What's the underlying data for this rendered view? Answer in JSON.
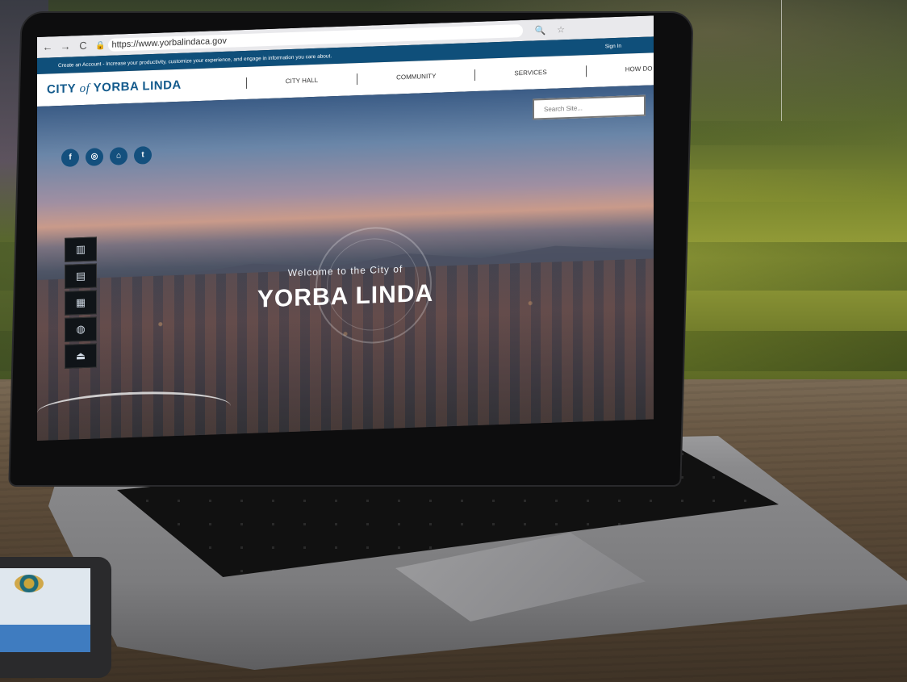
{
  "browser": {
    "url": "https://www.yorbalindaca.gov",
    "back_glyph": "←",
    "forward_glyph": "→",
    "reload_glyph": "C",
    "lock_glyph": "🔒",
    "search_glyph": "🔍",
    "star_glyph": "☆"
  },
  "promo": {
    "text": "Create an Account - Increase your productivity, customize your experience, and engage in information you care about.",
    "sign_in": "Sign In"
  },
  "header": {
    "logo_prefix": "CITY",
    "logo_of": "of",
    "logo_name": "YORBA LINDA",
    "nav": [
      "CITY HALL",
      "COMMUNITY",
      "SERVICES",
      "HOW DO I..."
    ]
  },
  "search": {
    "placeholder": "Search Site..."
  },
  "social": {
    "facebook": "f",
    "instagram": "◎",
    "home": "⌂",
    "twitter": "t"
  },
  "side_tools": [
    "▥",
    "▤",
    "▦",
    "◍",
    "⏏"
  ],
  "hero": {
    "welcome": "Welcome to the City of",
    "title": "YORBA LINDA"
  },
  "colors": {
    "brand_blue": "#135a8c",
    "promo_bar": "#0f4f7a",
    "social_bg": "#14507e"
  }
}
